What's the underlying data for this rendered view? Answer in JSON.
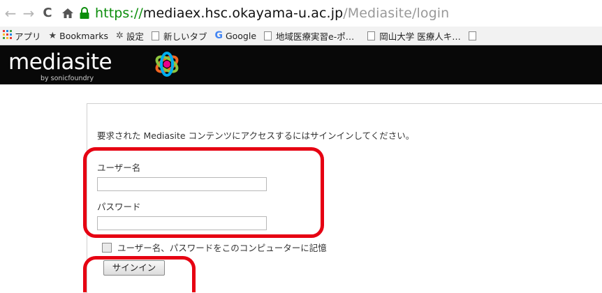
{
  "browser": {
    "nav": {
      "back_icon": "←",
      "forward_icon": "→",
      "reload_icon": "C",
      "home_icon": "⌂"
    },
    "url": {
      "scheme": "https://",
      "host": "mediaex.hsc.okayama-u.ac.jp",
      "path": "/Mediasite/login",
      "lock_color": "#0b8d0b"
    },
    "bookmarks": [
      {
        "icon": "apps-grid-icon",
        "label": "アプリ"
      },
      {
        "icon": "star-icon",
        "label": "Bookmarks"
      },
      {
        "icon": "gear-icon",
        "label": "設定"
      },
      {
        "icon": "page-icon",
        "label": "新しいタブ"
      },
      {
        "icon": "google-icon",
        "label": "Google"
      },
      {
        "icon": "page-icon",
        "label": "地域医療実習e-ポ…"
      },
      {
        "icon": "page-icon",
        "label": "岡山大学 医療人キ…"
      }
    ]
  },
  "header": {
    "logo_text": "mediasite",
    "logo_sub": "by sonicfoundry",
    "background": "#080808"
  },
  "login": {
    "notice": "要求された Mediasite コンテンツにアクセスするにはサインインしてください。",
    "username_label": "ユーザー名",
    "username_value": "",
    "password_label": "パスワード",
    "password_value": "",
    "remember_label": "ユーザー名、パスワードをこのコンピューターに記憶",
    "remember_checked": false,
    "signin_label": "サインイン"
  },
  "annotations": {
    "highlight_color": "#e60012"
  }
}
